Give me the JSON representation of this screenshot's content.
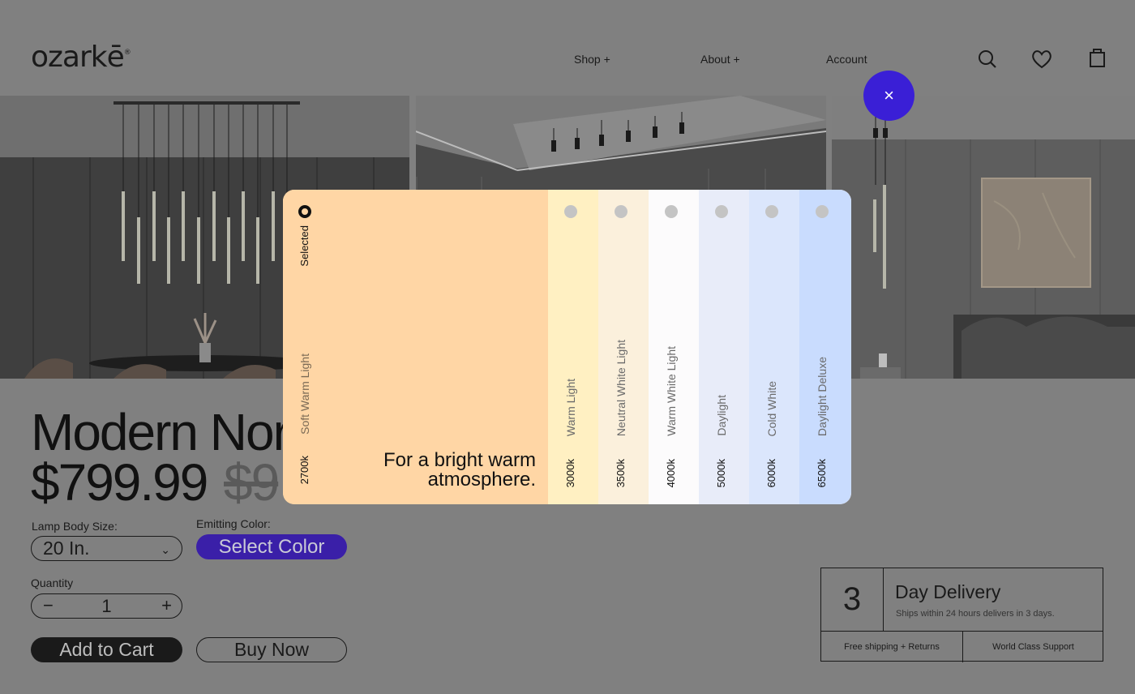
{
  "header": {
    "logo": "ozarkē",
    "logo_mark": "®",
    "nav": [
      "Shop +",
      "About +",
      "Account"
    ]
  },
  "product": {
    "title": "Modern Nor",
    "price": "$799.99",
    "old_price": "$9",
    "size_label": "Lamp Body Size:",
    "size_value": "20 In.",
    "color_label": "Emitting Color:",
    "color_button": "Select Color",
    "quantity_label": "Quantity",
    "quantity_value": "1",
    "add_to_cart": "Add to Cart",
    "buy_now": "Buy Now"
  },
  "delivery": {
    "number": "3",
    "title": "Day Delivery",
    "subtitle": "Ships within 24 hours delivers in 3 days.",
    "left": "Free shipping + Returns",
    "right": "World Class Support"
  },
  "close_icon": "×",
  "color_picker": {
    "selected_label": "Selected",
    "selected": {
      "name": "Soft Warm Light",
      "kelvin": "2700k",
      "description": "For a bright warm atmosphere.",
      "color": "#ffd6a5"
    },
    "options": [
      {
        "name": "Warm Light",
        "kelvin": "3000k",
        "color": "#fff0c2"
      },
      {
        "name": "Neutral White Light",
        "kelvin": "3500k",
        "color": "#fbf0dc"
      },
      {
        "name": "Warm White Light",
        "kelvin": "4000k",
        "color": "#fcfbfc"
      },
      {
        "name": "Daylight",
        "kelvin": "5000k",
        "color": "#e8ecf9"
      },
      {
        "name": "Cold White",
        "kelvin": "6000k",
        "color": "#dbe6fc"
      },
      {
        "name": "Daylight Deluxe",
        "kelvin": "6500k",
        "color": "#c9dcfe"
      }
    ]
  },
  "colors": {
    "accent": "#3a1fd6",
    "button_dark": "#1a1a1a",
    "select_color_bg": "#3a1fa8"
  }
}
